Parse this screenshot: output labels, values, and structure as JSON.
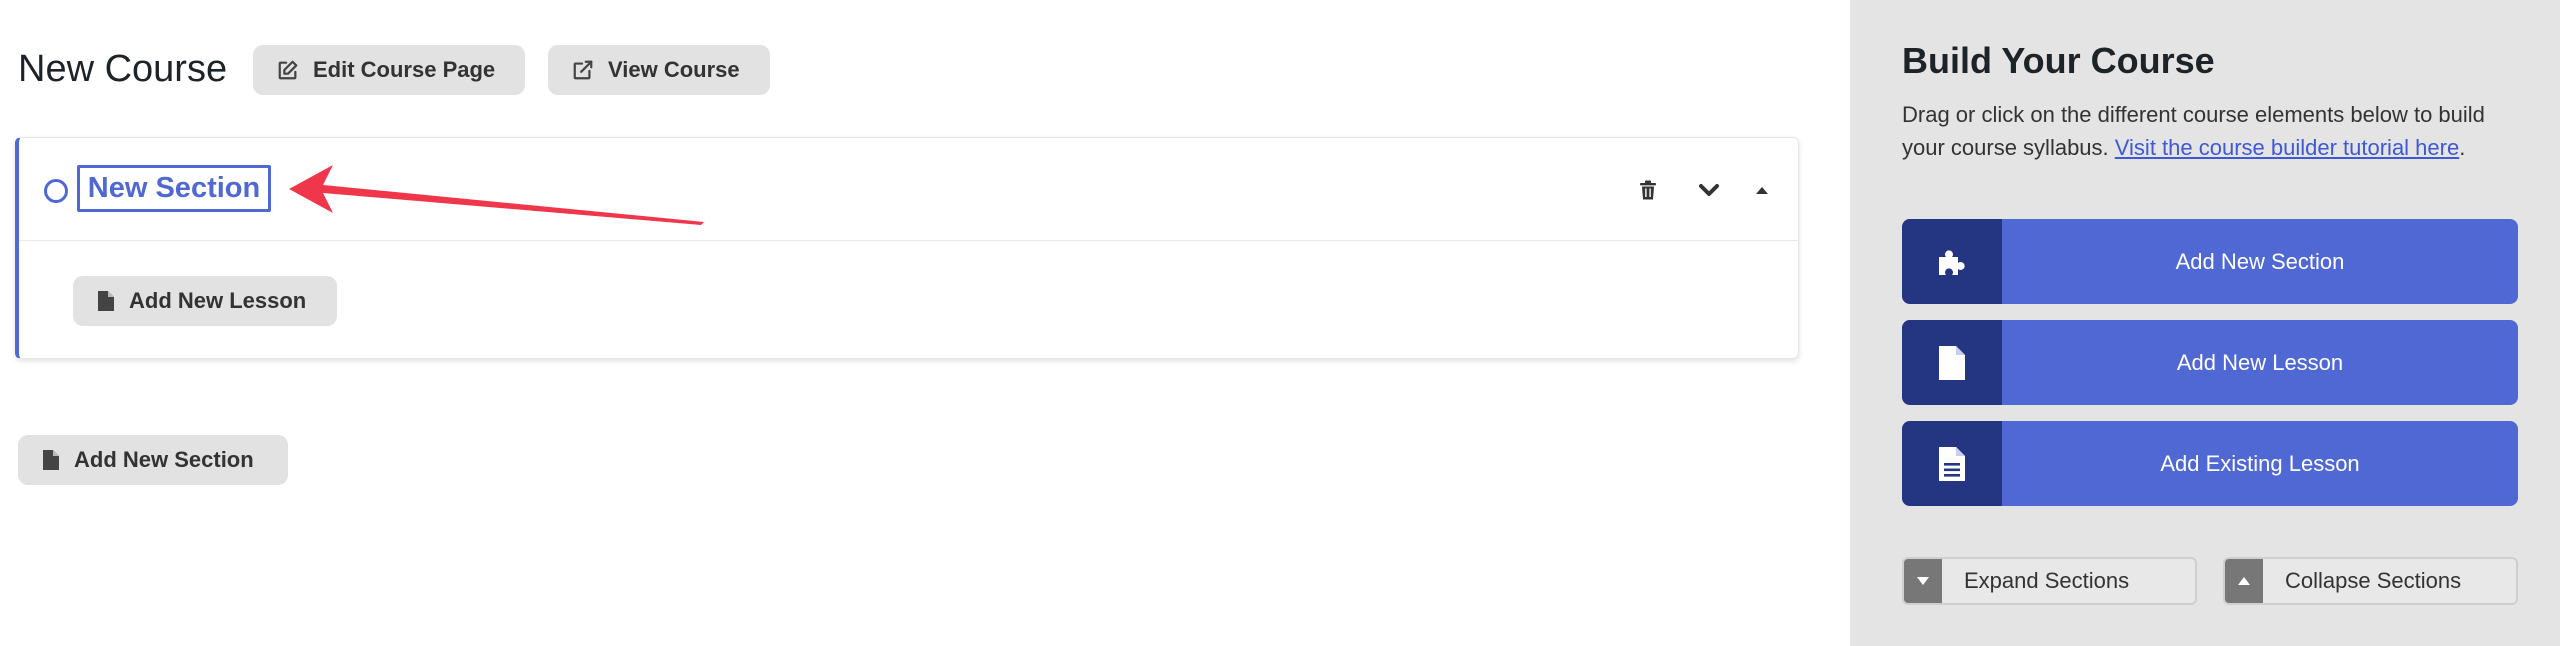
{
  "header": {
    "title": "New Course",
    "edit_course_page_label": "Edit Course Page",
    "view_course_label": "View Course"
  },
  "section": {
    "title": "New Section",
    "add_lesson_label": "Add New Lesson",
    "accent_color": "#4f68d4"
  },
  "footer": {
    "add_section_label": "Add New Section"
  },
  "sidebar": {
    "title": "Build Your Course",
    "description": "Drag or click on the different course elements below to build your course syllabus. ",
    "tutorial_link": "Visit the course builder tutorial here",
    "period": ".",
    "buttons": [
      {
        "label": "Add New Section",
        "icon": "puzzle-icon"
      },
      {
        "label": "Add New Lesson",
        "icon": "document-icon"
      },
      {
        "label": "Add Existing Lesson",
        "icon": "document-text-icon"
      }
    ],
    "expand_label": "Expand Sections",
    "collapse_label": "Collapse Sections",
    "button_color": "#4f68d4",
    "icon_bg_color": "#243582"
  },
  "annotation": {
    "arrow_color": "#f0364a"
  }
}
